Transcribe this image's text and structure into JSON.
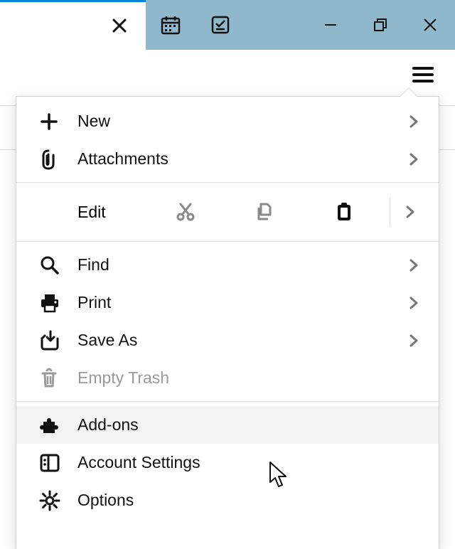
{
  "menu": {
    "new": "New",
    "attachments": "Attachments",
    "edit": "Edit",
    "find": "Find",
    "print": "Print",
    "saveAs": "Save As",
    "emptyTrash": "Empty Trash",
    "addons": "Add-ons",
    "accountSettings": "Account Settings",
    "options": "Options"
  }
}
